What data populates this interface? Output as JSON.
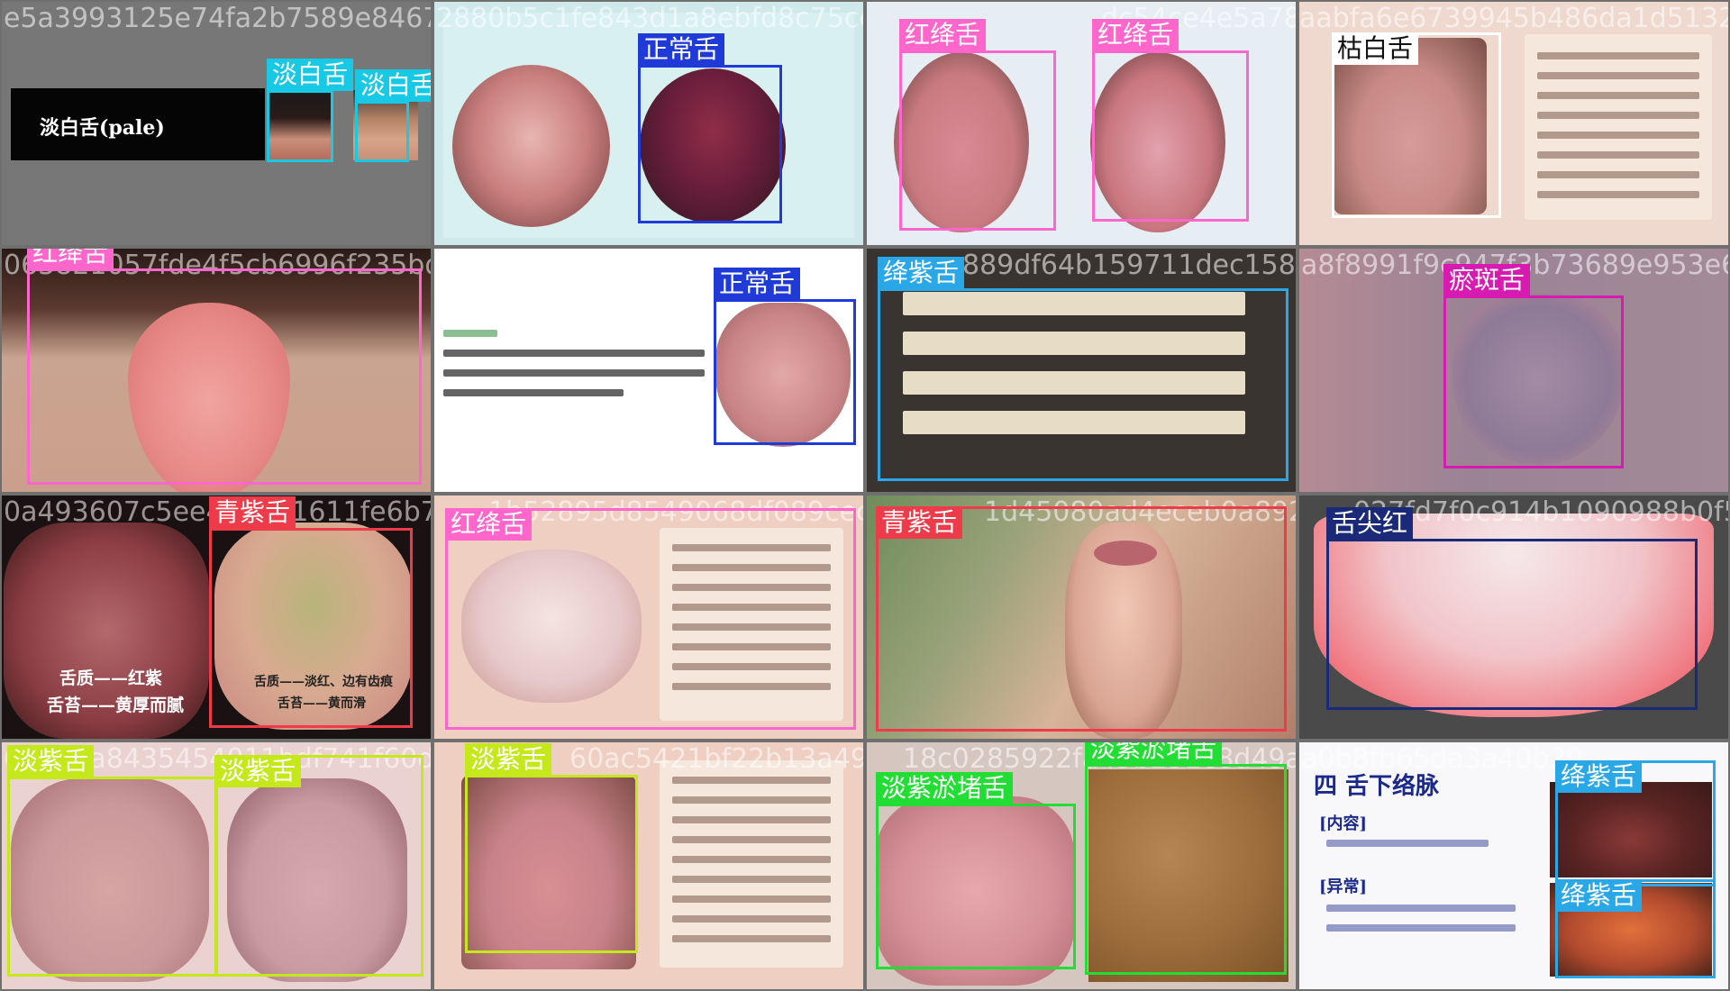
{
  "mosaic": {
    "tiles": [
      {
        "hash": "e5a3993125e74fa2b7589e8467993",
        "caption": "淡白舌(pale)",
        "boxes": [
          {
            "label": "淡白舌",
            "color": "#18c9e6"
          },
          {
            "label": "淡白舌",
            "color": "#18c9e6"
          }
        ]
      },
      {
        "hash": "2880b5c1fe843d1a8ebfd8c75cca5",
        "caption": "",
        "boxes": [
          {
            "label": "正常舌",
            "color": "#1f3ad6"
          }
        ]
      },
      {
        "hash": "dc54ce4e5a784f427e",
        "caption": "",
        "boxes": [
          {
            "label": "红绛舌",
            "color": "#ff66cc"
          },
          {
            "label": "红绛舌",
            "color": "#ff66cc"
          }
        ]
      },
      {
        "hash": "aabfa6e6739945b486da1d5132fb",
        "caption": "",
        "boxes": [
          {
            "label": "枯白舌",
            "color": "#ffffff"
          }
        ]
      },
      {
        "hash": "063821057fde4f5cb6996f235bd8691e.jpg",
        "caption": "",
        "boxes": [
          {
            "label": "红绛舌",
            "color": "#ff66cc"
          }
        ]
      },
      {
        "hash": "8e6b6fde35435cab09807128c35",
        "caption": "",
        "boxes": [
          {
            "label": "正常舌",
            "color": "#1f3ad6"
          }
        ]
      },
      {
        "hash": "889df64b159711dec15862754d",
        "caption": "",
        "boxes": [
          {
            "label": "绛紫舌",
            "color": "#2aa7e6"
          }
        ]
      },
      {
        "hash": "a8f8991f9c947f3b73689e953e63",
        "caption": "",
        "boxes": [
          {
            "label": "瘀斑舌",
            "color": "#d81bb0"
          }
        ]
      },
      {
        "hash": "0a493607c5ee45e6b1611fe6b7a2ea",
        "caption": "",
        "subcaptions": [
          "舌质——红紫",
          "舌苔——黄厚而腻",
          "舌质——淡红、边有齿痕",
          "舌苔——黄而滑"
        ],
        "boxes": [
          {
            "label": "青紫舌",
            "color": "#ee3b4a"
          }
        ]
      },
      {
        "hash": "1b52895d8549068df089cec0b7a6",
        "caption": "",
        "boxes": [
          {
            "label": "红绛舌",
            "color": "#ff66cc"
          }
        ]
      },
      {
        "hash": "1d45080ad4eceb0a8922c6620c45",
        "caption": "",
        "boxes": [
          {
            "label": "青紫舌",
            "color": "#ee3b4a"
          }
        ]
      },
      {
        "hash": "027fd7f0c914b1090988b0f5b60c",
        "caption": "",
        "boxes": [
          {
            "label": "舌尖红",
            "color": "#1a2a78"
          }
        ]
      },
      {
        "hash": "61b11a8435454011bdf741f60d6bf83b.jpg",
        "caption": "",
        "boxes": [
          {
            "label": "淡紫舌",
            "color": "#c5e81b"
          },
          {
            "label": "淡紫舌",
            "color": "#c5e81b"
          }
        ]
      },
      {
        "hash": "60ac5421bf22b13a49f",
        "caption": "",
        "boxes": [
          {
            "label": "淡紫舌",
            "color": "#c5e81b"
          }
        ]
      },
      {
        "hash": "18c0285922fa49b291c8d49afc9b1",
        "caption": "",
        "boxes": [
          {
            "label": "淡紫淤堵舌",
            "color": "#22dd33"
          },
          {
            "label": "淡紫淤堵舌",
            "color": "#22dd33"
          }
        ]
      },
      {
        "hash": "a0b8fb65da3a40b29",
        "caption": "",
        "slideTitle": "四 舌下络脉",
        "slideItems": [
          "[内容]",
          "[异常]"
        ],
        "boxes": [
          {
            "label": "绛紫舌",
            "color": "#2aa7e6"
          },
          {
            "label": "绛紫舌",
            "color": "#2aa7e6"
          }
        ]
      }
    ]
  }
}
